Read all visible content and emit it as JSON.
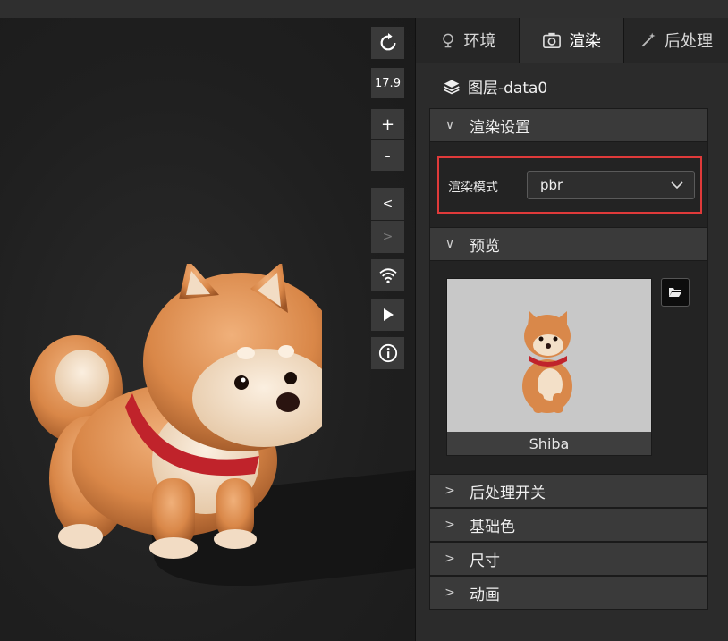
{
  "viewport_controls": {
    "zoom_value": "17.9",
    "plus": "+",
    "minus": "-",
    "prev": "<",
    "next": ">"
  },
  "tabs": [
    {
      "label": "环境",
      "icon": "bulb-icon"
    },
    {
      "label": "渲染",
      "icon": "camera-icon"
    },
    {
      "label": "后处理",
      "icon": "magic-wand-icon"
    }
  ],
  "layer": {
    "label": "图层-data0",
    "icon": "layers-icon"
  },
  "sections": {
    "render_settings": {
      "title": "渲染设置",
      "expanded": true
    },
    "preview": {
      "title": "预览",
      "expanded": true
    },
    "collapsed": [
      {
        "title": "后处理开关"
      },
      {
        "title": "基础色"
      },
      {
        "title": "尺寸"
      },
      {
        "title": "动画"
      }
    ]
  },
  "render_mode": {
    "label": "渲染模式",
    "value": "pbr"
  },
  "preview_model": {
    "name": "Shiba"
  },
  "colors": {
    "highlight": "#e03a3a",
    "panel_bg": "#2b2b2b",
    "section_bg": "#3a3a3a"
  }
}
